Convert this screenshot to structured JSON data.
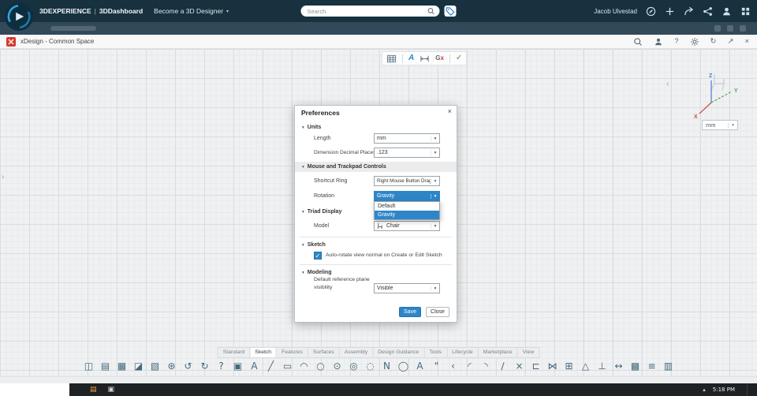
{
  "glyphs": {
    "caret_down": "▾",
    "section_caret": "▾",
    "help": "?",
    "sync": "↻",
    "open_external": "↗",
    "close": "×",
    "check": "✓",
    "chevron_left": "‹",
    "chevron_right": "›",
    "tray_caret": "▴",
    "folder": "▤",
    "app_square": "▣"
  },
  "top_bar": {
    "brand": "3DEXPERIENCE",
    "separator": "|",
    "platform": "3DDashboard",
    "dashboard_title": "Become a 3D Designer",
    "search_placeholder": "Search",
    "user_name": "Jacob Ulvestad"
  },
  "app_bar": {
    "title": "xDesign - Common Space"
  },
  "sketch_toolbar": {
    "a_label": "A",
    "gx_g": "G",
    "gx_x": "x"
  },
  "viewport": {
    "axis_x": "X",
    "axis_y": "Y",
    "axis_z": "Z",
    "units_value": "mm"
  },
  "dialog": {
    "title": "Preferences",
    "sections": {
      "units": {
        "title": "Units",
        "length_label": "Length",
        "length_value": "mm",
        "decimals_label": "Dimension Decimal Places",
        "decimals_value": ".123"
      },
      "mouse": {
        "title": "Mouse and Trackpad Controls",
        "shortcut_label": "Shortcut Ring",
        "shortcut_value": "Right Mouse Button Drag",
        "rotation_label": "Rotation",
        "rotation_value": "Gravity",
        "dropdown_options": [
          "Default",
          "Gravity"
        ],
        "dropdown_selected": "Gravity"
      },
      "triad_display": {
        "title": "Triad Display",
        "model_label": "Model",
        "model_value": "Chair"
      },
      "sketch": {
        "title": "Sketch",
        "checkbox_label": "Auto-rotate view normal on Create or Edit Sketch",
        "checkbox_checked": true
      },
      "modeling": {
        "title": "Modeling",
        "plane_label": "Default reference plane visibility",
        "plane_value": "Visible"
      }
    },
    "save_label": "Save",
    "close_label": "Close"
  },
  "bottom_tabs": {
    "tabs": [
      "Standard",
      "Sketch",
      "Features",
      "Surfaces",
      "Assembly",
      "Design Guidance",
      "Tools",
      "Lifecycle",
      "Marketplace",
      "View"
    ],
    "active": "Sketch"
  },
  "ribbon": {
    "icons": [
      {
        "name": "paste",
        "glyph": "◫"
      },
      {
        "name": "import-stamp",
        "glyph": "▤"
      },
      {
        "name": "save-data",
        "glyph": "▦"
      },
      {
        "name": "export-stamp",
        "glyph": "◪"
      },
      {
        "name": "sheet-edit",
        "glyph": "▧"
      },
      {
        "name": "settings-tool",
        "glyph": "⊛"
      },
      {
        "name": "undo",
        "glyph": "↺"
      },
      {
        "name": "redo",
        "glyph": "↻"
      },
      {
        "name": "help-tool",
        "glyph": "?"
      },
      {
        "name": "clipboard",
        "glyph": "▣"
      },
      {
        "name": "sketch-assistant",
        "glyph": "A"
      },
      {
        "name": "line-tool",
        "glyph": "╱"
      },
      {
        "name": "rectangle-tool",
        "glyph": "▭"
      },
      {
        "name": "arc-tool",
        "glyph": "◠"
      },
      {
        "name": "circle-tool",
        "glyph": "○"
      },
      {
        "name": "center-circle-tool",
        "glyph": "⊙"
      },
      {
        "name": "perimeter-circle-tool",
        "glyph": "◎"
      },
      {
        "name": "construction-circle-tool",
        "glyph": "◌"
      },
      {
        "name": "spline-tool",
        "glyph": "N"
      },
      {
        "name": "ellipse-tool",
        "glyph": "◯"
      },
      {
        "name": "text-tool",
        "glyph": "A"
      },
      {
        "name": "note-tool",
        "glyph": "\""
      },
      {
        "name": "group-collapse",
        "glyph": "‹"
      },
      {
        "name": "corner-arc-tool",
        "glyph": "◜"
      },
      {
        "name": "tangent-arc-tool",
        "glyph": "◝"
      },
      {
        "name": "polyline-tool",
        "glyph": "∕"
      },
      {
        "name": "trim-tool",
        "glyph": "×"
      },
      {
        "name": "offset-tool",
        "glyph": "⊏"
      },
      {
        "name": "mirror-tool",
        "glyph": "⋈"
      },
      {
        "name": "pattern-tool",
        "glyph": "⊞"
      },
      {
        "name": "constraint-triangle-tool",
        "glyph": "△"
      },
      {
        "name": "perpendicular-tool",
        "glyph": "⊥"
      },
      {
        "name": "dimension-tool",
        "glyph": "↔"
      },
      {
        "name": "snap-grid-tool",
        "glyph": "▩"
      },
      {
        "name": "display-list-tool",
        "glyph": "≡"
      },
      {
        "name": "table-tool",
        "glyph": "▥"
      }
    ]
  },
  "taskbar": {
    "time": "5:18 PM"
  },
  "colors": {
    "accent_blue": "#2e86c9",
    "topbar_navy": "#17313f",
    "selection_blue": "#2e86c9",
    "xdesign_red": "#d63a2f"
  }
}
